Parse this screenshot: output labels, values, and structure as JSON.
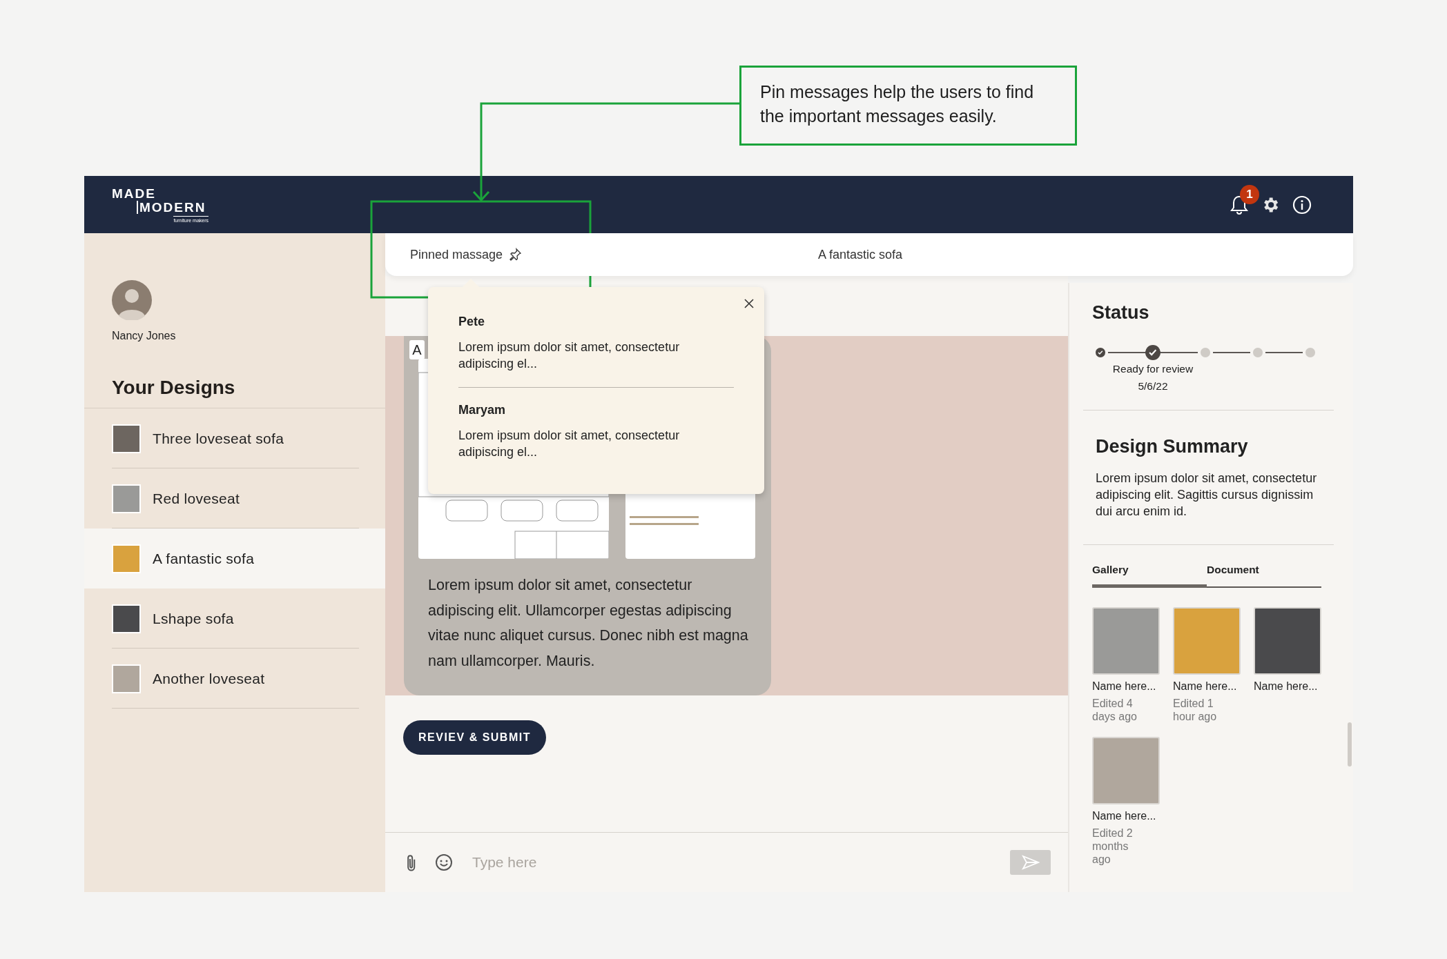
{
  "annotation": {
    "text": "Pin messages help the users to find the important messages easily."
  },
  "header": {
    "logo": {
      "line_1": "MADE",
      "line_2": "MODERN",
      "tagline": "furniture makers"
    },
    "notification_count": "1"
  },
  "sidebar": {
    "user": {
      "name": "Nancy Jones"
    },
    "section_title": "Your Designs",
    "items": [
      {
        "label": "Three loveseat sofa",
        "selected": false
      },
      {
        "label": "Red loveseat",
        "selected": false
      },
      {
        "label": "A fantastic sofa",
        "selected": true
      },
      {
        "label": "Lshape sofa",
        "selected": false
      },
      {
        "label": "Another loveseat",
        "selected": false
      }
    ]
  },
  "chat": {
    "pinned_label": "Pinned massage",
    "title": "A fantastic sofa",
    "pinned_messages": [
      {
        "author": "Pete",
        "text": "Lorem ipsum dolor sit amet, consectetur adipiscing el..."
      },
      {
        "author": "Maryam",
        "text": "Lorem ipsum dolor sit amet, consectetur adipiscing el..."
      }
    ],
    "message": {
      "tag": "A",
      "text": "Lorem ipsum dolor sit amet, consectetur adipiscing elit. Ullamcorper egestas adipiscing vitae nunc aliquet cursus. Donec nibh est magna nam ullamcorper. Mauris."
    },
    "submit_button": "REVIEV & SUBMIT",
    "composer": {
      "placeholder": "Type here"
    }
  },
  "status": {
    "title": "Status",
    "steps": [
      {
        "done": true,
        "selected": false
      },
      {
        "done": true,
        "selected": true,
        "label": "Ready for review",
        "date": "5/6/22"
      },
      {
        "done": false,
        "selected": false
      },
      {
        "done": false,
        "selected": false
      },
      {
        "done": false,
        "selected": false
      }
    ]
  },
  "design_summary": {
    "title": "Design Summary",
    "text": "Lorem ipsum dolor sit amet, consectetur adipiscing elit. Sagittis cursus dignissim dui arcu enim id."
  },
  "tabs": [
    {
      "label": "Gallery",
      "selected": true
    },
    {
      "label": "Document",
      "selected": false
    }
  ],
  "gallery": [
    {
      "name": "Name here...",
      "edited": "Edited 4 days ago"
    },
    {
      "name": "Name here...",
      "edited": "Edited 1 hour ago"
    },
    {
      "name": "Name here..."
    },
    {
      "name": "Name here...",
      "edited": "Edited 2 months ago"
    }
  ]
}
